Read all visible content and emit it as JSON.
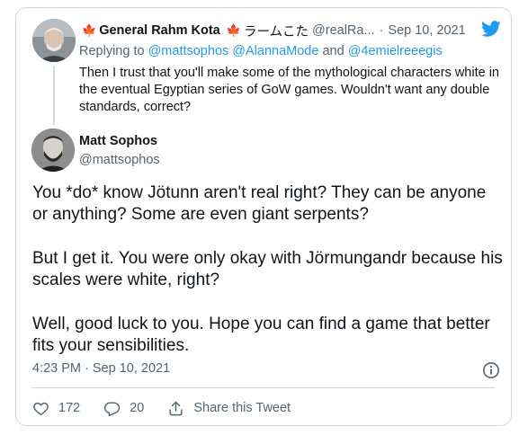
{
  "parent_tweet": {
    "flag_left": "🍁",
    "display_name": "General Rahm Kota",
    "flag_right": "🍁",
    "name_suffix": "ラームこた",
    "handle": "@realRa...",
    "separator": "·",
    "date": "Sep 10, 2021",
    "replying_prefix": "Replying to",
    "replying_mentions": "@mattsophos @AlannaMode",
    "replying_and": "and",
    "replying_last": "@4emielreeegis",
    "text": "Then I trust that you'll make some of the mythological characters white in the eventual Egyptian series of GoW games. Wouldn't want any double standards, correct?"
  },
  "main_tweet": {
    "display_name": "Matt Sophos",
    "handle": "@mattsophos",
    "paragraphs": [
      "You *do* know Jötunn aren't real right? They can be anyone or anything? Some are even giant serpents?",
      "But I get it. You were only okay with Jörmungandr because his scales were white, right?",
      "Well, good luck to you. Hope you can find a game that better fits your sensibilities."
    ],
    "timestamp": "4:23 PM · Sep 10, 2021"
  },
  "actions": {
    "likes": "172",
    "replies": "20",
    "share_label": "Share this Tweet"
  },
  "icons": {
    "brand": "twitter-bird-icon",
    "info": "info-icon",
    "like": "heart-icon",
    "reply": "reply-icon",
    "share": "share-icon"
  },
  "colors": {
    "brand_blue": "#1d9bf0",
    "secondary_text": "#536471",
    "border": "#cfd9de"
  }
}
